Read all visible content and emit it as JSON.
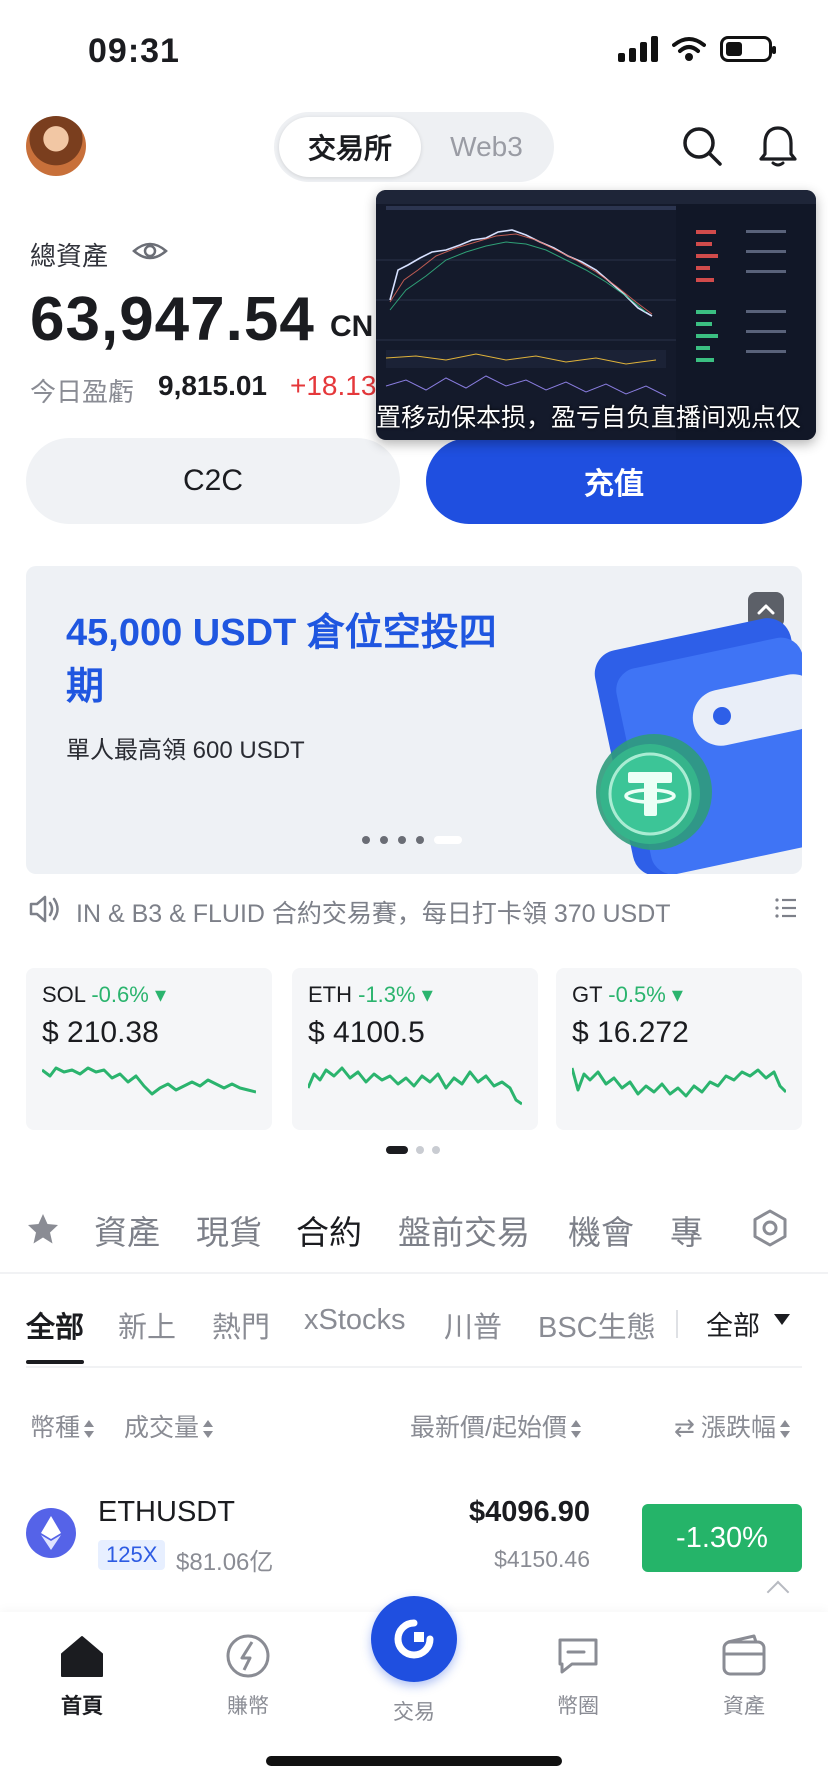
{
  "status_bar": {
    "time": "09:31"
  },
  "header": {
    "segment_active": "交易所",
    "segment_inactive": "Web3"
  },
  "assets": {
    "label": "總資產",
    "balance": "63,947.54",
    "currency": "CN",
    "pnl_label": "今日盈虧",
    "pnl_value": "9,815.01",
    "pnl_pct": "+18.13"
  },
  "actions": {
    "c2c": "C2C",
    "deposit": "充值"
  },
  "video_overlay": {
    "caption": "置移动保本损，盈亏自负直播间观点仅"
  },
  "banner": {
    "title": "45,000 USDT 倉位空投四期",
    "subtitle": "單人最高領 600 USDT",
    "page_count": 5,
    "active_page": 5
  },
  "announcement": {
    "text": "IN & B3 & FLUID 合約交易賽，每日打卡領 370 USDT"
  },
  "tickers": [
    {
      "symbol": "SOL",
      "change": "-0.6%",
      "price": "$ 210.38"
    },
    {
      "symbol": "ETH",
      "change": "-1.3%",
      "price": "$ 4100.5"
    },
    {
      "symbol": "GT",
      "change": "-0.5%",
      "price": "$ 16.272"
    }
  ],
  "category_tabs": [
    "資產",
    "現貨",
    "合約",
    "盤前交易",
    "機會",
    "專"
  ],
  "category_active": "合約",
  "sub_tabs": [
    "全部",
    "新上",
    "熱門",
    "xStocks",
    "川普",
    "BSC生態"
  ],
  "sub_filter": "全部",
  "columns": {
    "coin": "幣種",
    "volume": "成交量",
    "price": "最新價/起始價",
    "change": "漲跌幅",
    "change_icon": "swap-icon"
  },
  "rows": [
    {
      "symbol": "ETHUSDT",
      "leverage": "125X",
      "volume": "$81.06亿",
      "price": "$4096.90",
      "open_price": "$4150.46",
      "change": "-1.30%"
    }
  ],
  "tabbar": {
    "home": "首頁",
    "earn": "賺幣",
    "trade": "交易",
    "feed": "幣圈",
    "assets": "資產"
  },
  "colors": {
    "accent": "#1f4fe0",
    "positive": "#2bb46e",
    "negative": "#e5383b",
    "badge_green": "#25b469"
  }
}
